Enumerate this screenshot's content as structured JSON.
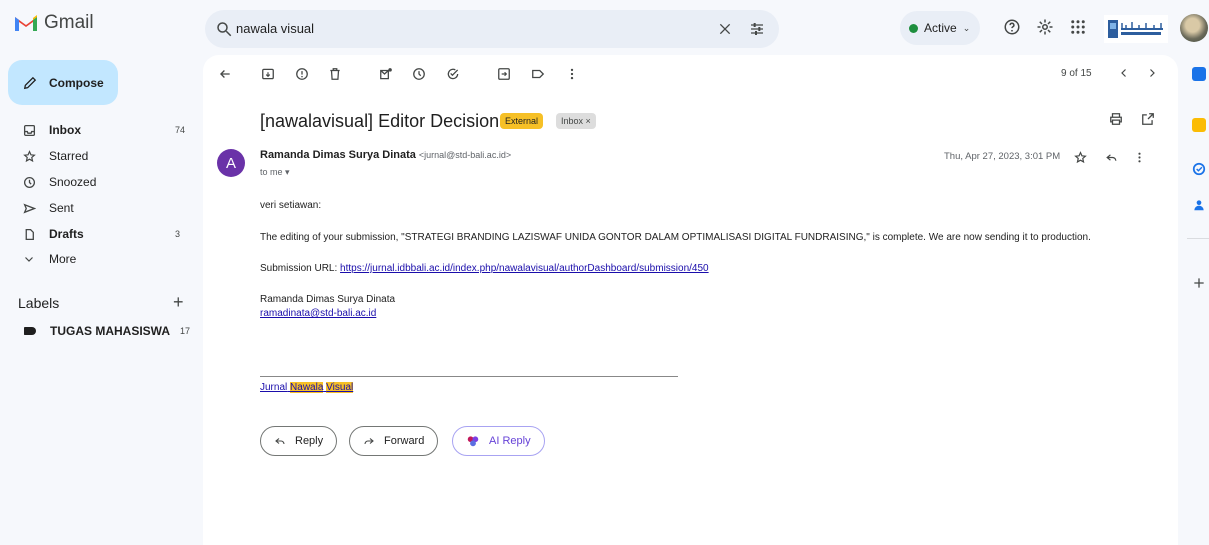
{
  "header": {
    "app_name": "Gmail",
    "search_value": "nawala visual",
    "status_label": "Active"
  },
  "sidebar": {
    "compose_label": "Compose",
    "items": [
      {
        "label": "Inbox",
        "count": "74"
      },
      {
        "label": "Starred",
        "count": ""
      },
      {
        "label": "Snoozed",
        "count": ""
      },
      {
        "label": "Sent",
        "count": ""
      },
      {
        "label": "Drafts",
        "count": "3"
      },
      {
        "label": "More",
        "count": ""
      }
    ],
    "labels_heading": "Labels",
    "label_item": {
      "label": "TUGAS MAHASISWA",
      "count": "17"
    }
  },
  "toolbar": {
    "pager": "9 of 15"
  },
  "email": {
    "subject": "[nawalavisual] Editor Decision",
    "badge_external": "External",
    "badge_inbox": "Inbox ×",
    "sender_initial": "A",
    "sender_name": "Ramanda Dimas Surya Dinata",
    "sender_email": "<jurnal@std-bali.ac.id>",
    "recipient": "to me ▾",
    "date": "Thu, Apr 27, 2023, 3:01 PM",
    "greeting": "veri setiawan:",
    "paragraph": "The editing of your submission, \"STRATEGI BRANDING LAZISWAF UNIDA GONTOR DALAM OPTIMALISASI DIGITAL FUNDRAISING,\" is complete. We are now sending it to production.",
    "submission_label": "Submission URL:",
    "submission_url": "https://jurnal.idbbali.ac.id/index.php/nawalavisual/authorDashboard/submission/450",
    "signature_name": "Ramanda Dimas Surya Dinata",
    "signature_email": "ramadinata@std-bali.ac.id",
    "journal_prefix": "Jurnal",
    "journal_word1": "Nawala",
    "journal_word2": "Visual"
  },
  "actions": {
    "reply": "Reply",
    "forward": "Forward",
    "ai_reply": "AI Reply"
  },
  "colors": {
    "accent_blue": "#c2e7ff",
    "external_badge": "#f6c026",
    "avatar_purple": "#6a32a8",
    "active_green": "#1e8e3e"
  }
}
